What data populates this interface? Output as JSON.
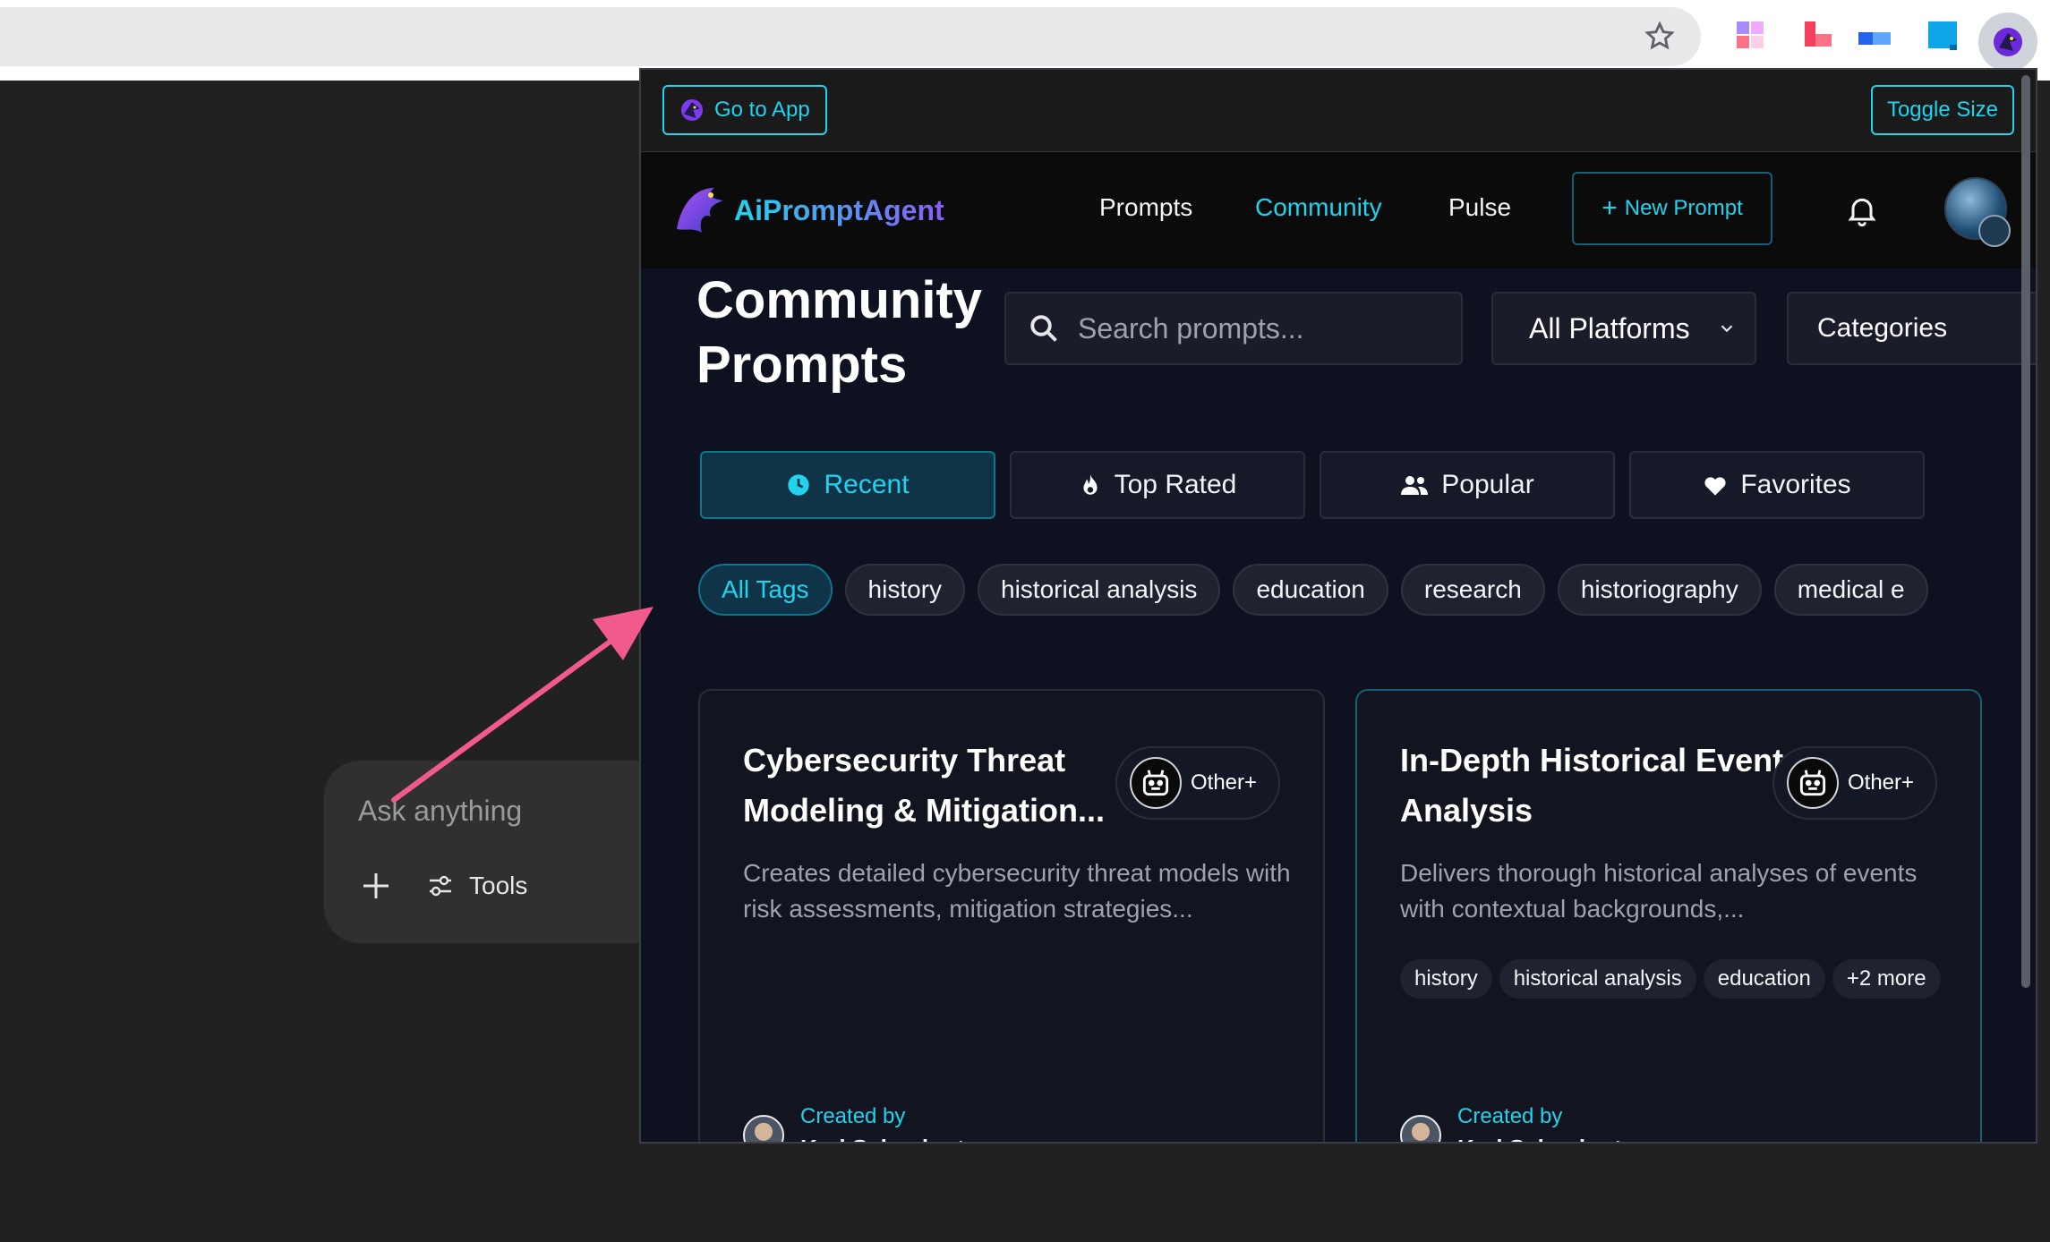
{
  "browser": {
    "star_icon": "star-icon",
    "extensions": [
      "puzzle-grid-icon",
      "red-blocks-icon",
      "blue-bar-icon",
      "blue-square-icon"
    ],
    "active_extension_icon": "eagle-icon"
  },
  "chat": {
    "placeholder": "Ask anything",
    "tools_label": "Tools"
  },
  "popup": {
    "go_to_app": "Go to App",
    "toggle_size": "Toggle Size"
  },
  "nav": {
    "brand": "AiPromptAgent",
    "links": [
      "Prompts",
      "Community",
      "Pulse"
    ],
    "active_link": "Community",
    "new_prompt": "New Prompt"
  },
  "page": {
    "title": "Community Prompts",
    "search_placeholder": "Search prompts...",
    "platform_selected": "All Platforms",
    "categories": "Categories"
  },
  "sort_tabs": [
    {
      "label": "Recent",
      "icon": "clock-icon",
      "active": true
    },
    {
      "label": "Top Rated",
      "icon": "flame-icon",
      "active": false
    },
    {
      "label": "Popular",
      "icon": "users-icon",
      "active": false
    },
    {
      "label": "Favorites",
      "icon": "heart-icon",
      "active": false
    }
  ],
  "tags": [
    "All Tags",
    "history",
    "historical analysis",
    "education",
    "research",
    "historiography",
    "medical e"
  ],
  "cards": [
    {
      "title": "Cybersecurity Threat Modeling & Mitigation...",
      "platform": "Other+",
      "description": "Creates detailed cybersecurity threat models with risk assessments, mitigation strategies...",
      "tags": [],
      "created_by_label": "Created by",
      "creator": "Karl Schuckert"
    },
    {
      "title": "In-Depth Historical Event Analysis",
      "platform": "Other+",
      "description": "Delivers thorough historical analyses of events with contextual backgrounds,...",
      "tags": [
        "history",
        "historical analysis",
        "education",
        "+2 more"
      ],
      "created_by_label": "Created by",
      "creator": "Karl Schuckert"
    }
  ],
  "colors": {
    "accent": "#22d3ee",
    "annotation_arrow": "#f25a8c",
    "popup_bg": "#0e1120"
  }
}
